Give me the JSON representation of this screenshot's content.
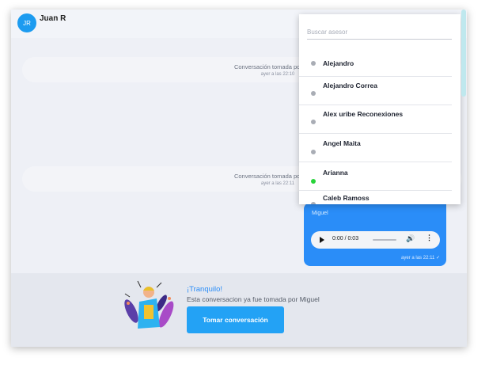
{
  "header": {
    "avatar_initials": "JR",
    "contact_name": "Juan R"
  },
  "messages": [
    {
      "text": "Conversación tomada por Miguel",
      "time": "ayer a las 22:10"
    },
    {
      "text": "Conversación tomada por Miguel",
      "time": "ayer a las 22:11"
    }
  ],
  "audio_message": {
    "sender": "Miguel",
    "player_time": "0:00 / 0:03",
    "progress": 0,
    "timestamp": "ayer a las 22:11",
    "bubble_color": "#2a8df8"
  },
  "agent_dropdown": {
    "search_placeholder": "Buscar asesor",
    "agents": [
      {
        "name": "Alejandro",
        "status": "offline",
        "color": "#a9adb5"
      },
      {
        "name": "Alejandro Correa",
        "status": "offline",
        "color": "#a9adb5"
      },
      {
        "name": "Alex uribe Reconexiones",
        "status": "offline",
        "color": "#a9adb5"
      },
      {
        "name": "Angel Maita",
        "status": "offline",
        "color": "#a9adb5"
      },
      {
        "name": "Arianna",
        "status": "online",
        "color": "#28d43a"
      },
      {
        "name": "Caleb Ramoss",
        "status": "offline",
        "color": "#a9adb5"
      }
    ]
  },
  "footer": {
    "title": "¡Tranquilo!",
    "text": "Esta conversacion ya fue tomada por Miguel",
    "button_label": "Tomar conversación",
    "accent_color": "#23a2f5"
  }
}
